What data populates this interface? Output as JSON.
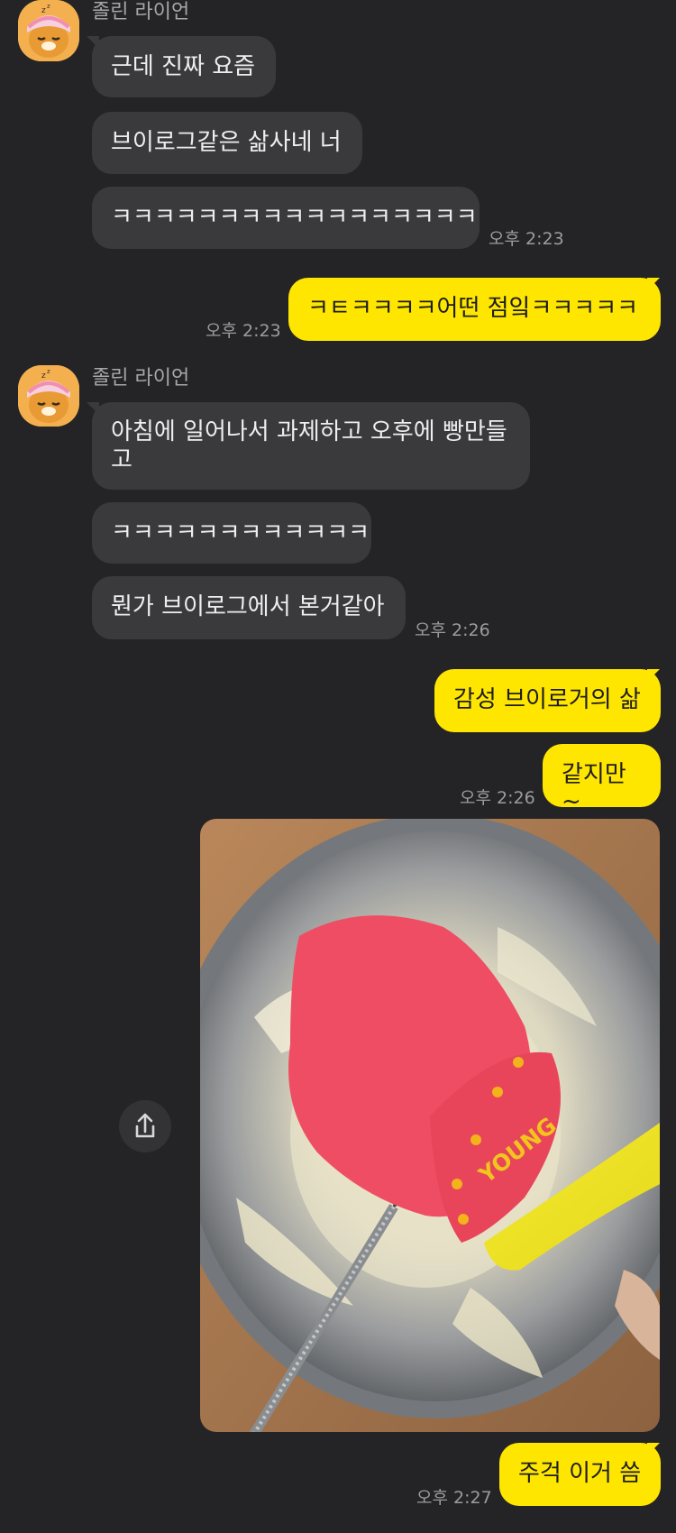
{
  "chat": {
    "sender_name": "졸린 라이언",
    "messages": [
      {
        "id": "m1",
        "text": "근데 진짜 요즘"
      },
      {
        "id": "m2",
        "text": "브이로그같은 삶사네 너"
      },
      {
        "id": "m3",
        "text": "ㅋㅋㅋㅋㅋㅋㅋㅋㅋㅋㅋㅋㅋㅋㅋㅋㅋ"
      },
      {
        "id": "m4",
        "text": "ㅋㅌㅋㅋㅋㅋ어떤 점잌ㅋㅋㅋㅋㅋ"
      },
      {
        "id": "m5",
        "text": "아침에 일어나서 과제하고 오후에 빵만들\n고"
      },
      {
        "id": "m6",
        "text": "ㅋㅋㅋㅋㅋㅋㅋㅋㅋㅋㅋㅋ"
      },
      {
        "id": "m7",
        "text": "뭔가 브이로그에서 본거같아"
      },
      {
        "id": "m8",
        "text": "감성 브이로거의 삶"
      },
      {
        "id": "m9",
        "text": "같지만~"
      },
      {
        "id": "m10",
        "text": "주걱 이거 씀"
      }
    ],
    "timestamps": {
      "t1": "오후 2:23",
      "t2": "오후 2:23",
      "t3": "오후 2:26",
      "t4": "오후 2:26",
      "t5": "오후 2:27"
    },
    "photo_text": "YOUNG"
  },
  "colors": {
    "background": "#242427",
    "incoming_bubble": "#3a3a3c",
    "outgoing_bubble": "#ffe600",
    "timestamp": "#9b9ba0"
  },
  "icons": {
    "avatar": "sleepy-lion-icon",
    "share": "share-icon"
  }
}
